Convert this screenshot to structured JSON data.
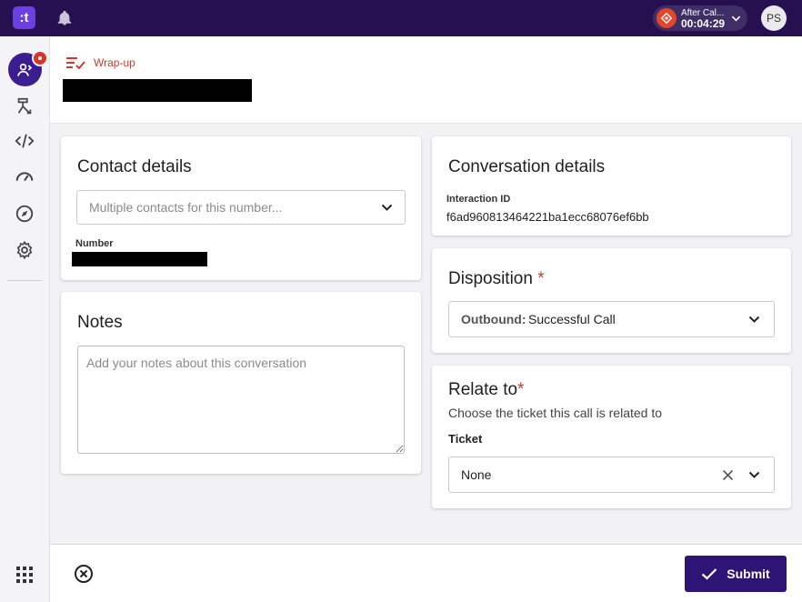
{
  "topbar": {
    "logo_text": ":t",
    "call": {
      "status": "After Cal...",
      "timer": "00:04:29"
    },
    "avatar_initials": "PS"
  },
  "header": {
    "label": "Wrap-up"
  },
  "contact": {
    "title": "Contact details",
    "select_placeholder": "Multiple contacts for this number...",
    "number_label": "Number"
  },
  "notes": {
    "title": "Notes",
    "placeholder": "Add your notes about this conversation"
  },
  "conversation": {
    "title": "Conversation details",
    "interaction_label": "Interaction ID",
    "interaction_id": "f6ad960813464221ba1ecc68076ef6bb"
  },
  "disposition": {
    "title": "Disposition",
    "required_mark": "*",
    "prefix": "Outbound:",
    "value": "Successful Call"
  },
  "relate": {
    "title": "Relate to",
    "required_mark": "*",
    "description": "Choose the ticket this call is related to",
    "ticket_label": "Ticket",
    "ticket_value": "None"
  },
  "footer": {
    "submit_label": "Submit"
  },
  "colors": {
    "topbar": "#26104f",
    "accent": "#2e1475",
    "required": "#d0392b"
  }
}
